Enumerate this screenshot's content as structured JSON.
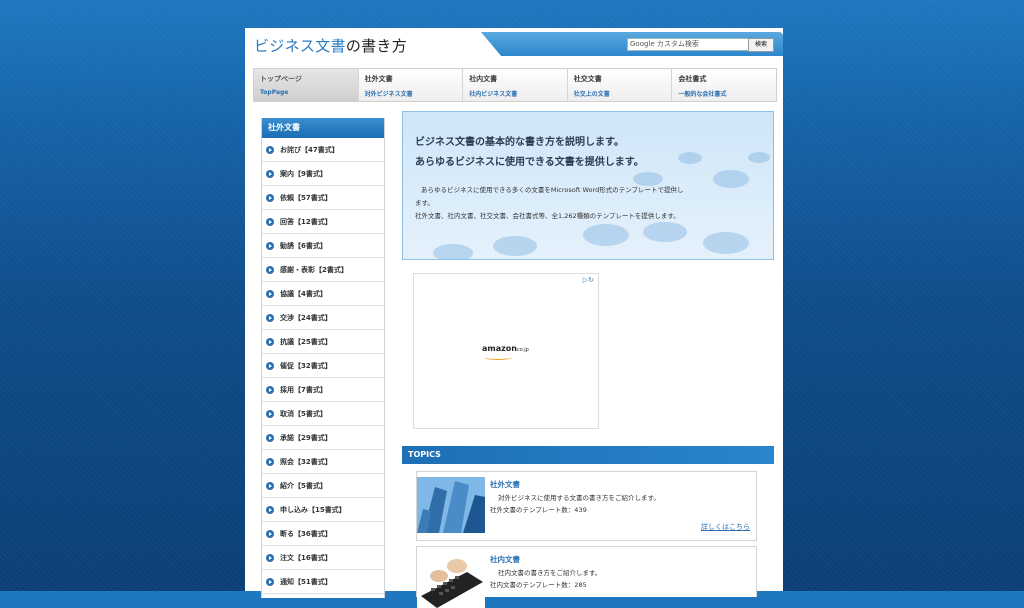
{
  "header": {
    "title_colored": "ビジネス文書",
    "title_rest": "の書き方",
    "search_placeholder": "Google カスタム検索",
    "search_button": "検索"
  },
  "nav": [
    {
      "title": "トップページ",
      "sub": "TopPage",
      "active": true
    },
    {
      "title": "社外文書",
      "sub": "対外ビジネス文書"
    },
    {
      "title": "社内文書",
      "sub": "社内ビジネス文書"
    },
    {
      "title": "社交文書",
      "sub": "社交上の文書"
    },
    {
      "title": "会社書式",
      "sub": "一般的な会社書式"
    }
  ],
  "sidebar": {
    "header": "社外文書",
    "items": [
      "お詫び【47書式】",
      "案内【9書式】",
      "依頼【57書式】",
      "回答【12書式】",
      "勧誘【6書式】",
      "感謝・表彰【2書式】",
      "協議【4書式】",
      "交渉【24書式】",
      "抗議【25書式】",
      "催促【32書式】",
      "採用【7書式】",
      "取消【5書式】",
      "承諾【29書式】",
      "照会【32書式】",
      "紹介【5書式】",
      "申し込み【15書式】",
      "断る【36書式】",
      "注文【16書式】",
      "通知【51書式】"
    ]
  },
  "hero": {
    "line1": "ビジネス文書の基本的な書き方を説明します。",
    "line2": "あらゆるビジネスに使用できる文書を提供します。",
    "body1": "あらゆるビジネスに使用できる多くの文書をMicrosoft Word形式のテンプレートで提供し",
    "body2": "ます。",
    "body3": "社外文書、社内文書、社交文書、会社書式等、全1,262種類のテンプレートを提供します。"
  },
  "ad": {
    "brand": "amazon",
    "brand_suffix": "co.jp"
  },
  "topics": {
    "header": "TOPICS",
    "cards": [
      {
        "title": "社外文書",
        "desc": "対外ビジネスに使用する文書の書き方をご紹介します。",
        "count": "社外文書のテンプレート数：439",
        "more": "詳しくはこちら"
      },
      {
        "title": "社内文書",
        "desc": "社内文書の書き方をご紹介します。",
        "count": "社内文書のテンプレート数：285"
      }
    ]
  },
  "colors": {
    "accent": "#2a6fb0",
    "background": "#1663a8"
  }
}
